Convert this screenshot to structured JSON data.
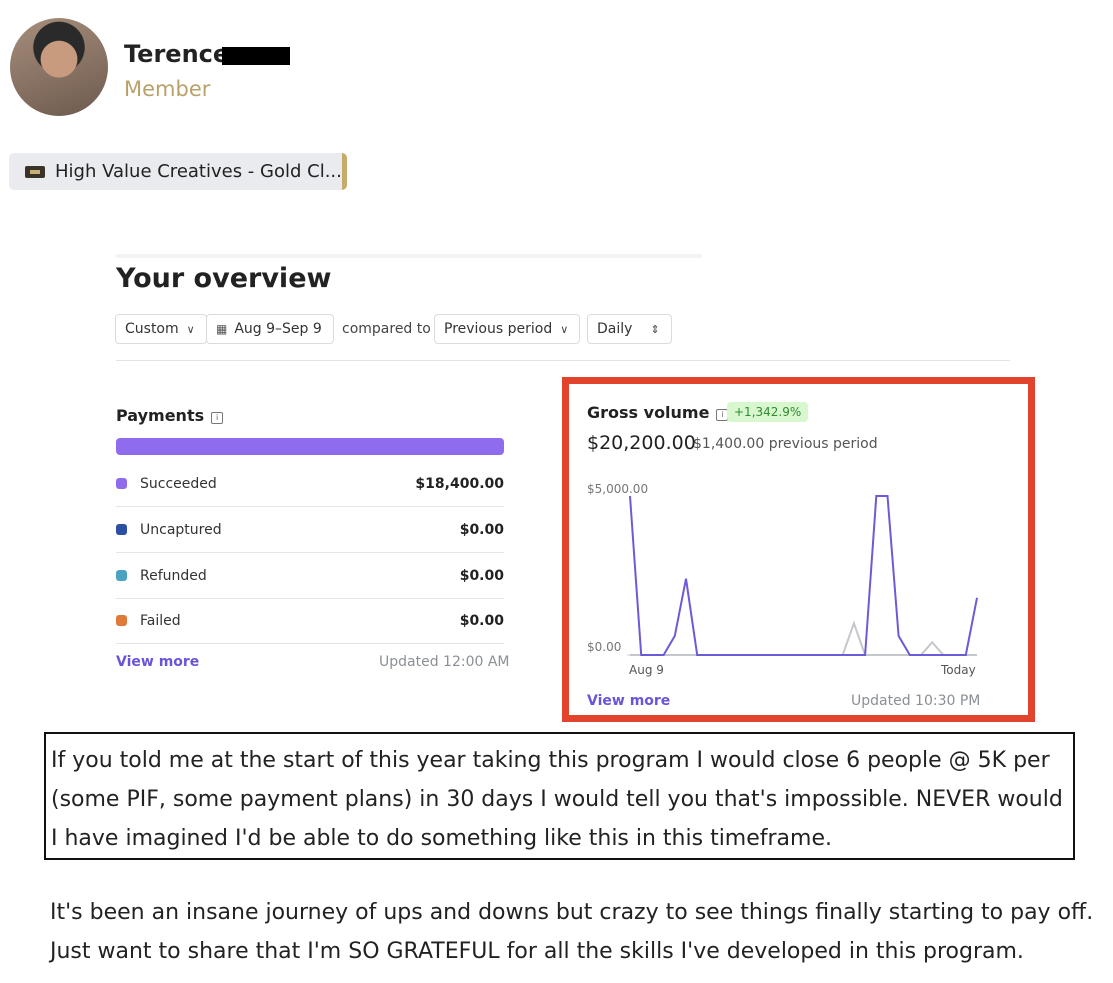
{
  "post": {
    "author_name": "Terence",
    "author_role": "Member",
    "group_chip": "High Value Creatives - Gold Cl...",
    "quote": "If you told me at the start of this year taking this program I would close 6 people @ 5K per (some PIF, some payment plans) in 30 days I would tell you that's impossible. NEVER would I have imagined I'd be able to do something like this in this timeframe.",
    "body": "It's been an insane journey of ups and downs but crazy to see things finally starting to pay off. Just want to share that I'm SO GRATEFUL for all the skills I've developed in this program."
  },
  "overview": {
    "title": "Your overview",
    "filters": {
      "range_type": "Custom",
      "date_range": "Aug 9–Sep 9",
      "compared_label": "compared to",
      "comparison": "Previous period",
      "interval": "Daily"
    },
    "payments": {
      "title": "Payments",
      "bar_fill_fraction": 1.0,
      "bar_color": "#8f6cee",
      "rows": [
        {
          "label": "Succeeded",
          "amount": "$18,400.00",
          "color": "#8f6cee"
        },
        {
          "label": "Uncaptured",
          "amount": "$0.00",
          "color": "#2a4fa3"
        },
        {
          "label": "Refunded",
          "amount": "$0.00",
          "color": "#4aa3c0"
        },
        {
          "label": "Failed",
          "amount": "$0.00",
          "color": "#e07a3a"
        }
      ],
      "view_more": "View more",
      "updated": "Updated 12:00 AM"
    },
    "gross_volume": {
      "title": "Gross volume",
      "change_badge": "+1,342.9%",
      "total": "$20,200.00",
      "previous": "$1,400.00 previous period",
      "view_more": "View more",
      "updated": "Updated 10:30 PM",
      "highlight_color": "#e2432c"
    }
  },
  "chart_data": {
    "type": "line",
    "title": "",
    "xlabel": "",
    "ylabel": "",
    "ylim": [
      0,
      6000
    ],
    "y_ticks": [
      "$5,000.00",
      "$0.00"
    ],
    "x_ticks": [
      "Aug 9",
      "Today"
    ],
    "x": [
      0,
      1,
      2,
      3,
      4,
      5,
      6,
      7,
      8,
      9,
      10,
      11,
      12,
      13,
      14,
      15,
      16,
      17,
      18,
      19,
      20,
      21,
      22,
      23,
      24,
      25,
      26,
      27,
      28,
      29,
      30,
      31
    ],
    "series": [
      {
        "color": "#6b5bd6",
        "values": [
          5000,
          0,
          0,
          0,
          600,
          2400,
          0,
          0,
          0,
          0,
          0,
          0,
          0,
          0,
          0,
          0,
          0,
          0,
          0,
          0,
          0,
          0,
          5000,
          5000,
          600,
          0,
          0,
          0,
          0,
          0,
          0,
          1800
        ]
      },
      {
        "color": "#c4c7cc",
        "values": [
          0,
          0,
          0,
          0,
          0,
          0,
          0,
          0,
          0,
          0,
          0,
          0,
          0,
          0,
          0,
          0,
          0,
          0,
          0,
          0,
          1000,
          0,
          0,
          0,
          0,
          0,
          0,
          400,
          0,
          0,
          0,
          0
        ]
      }
    ]
  }
}
